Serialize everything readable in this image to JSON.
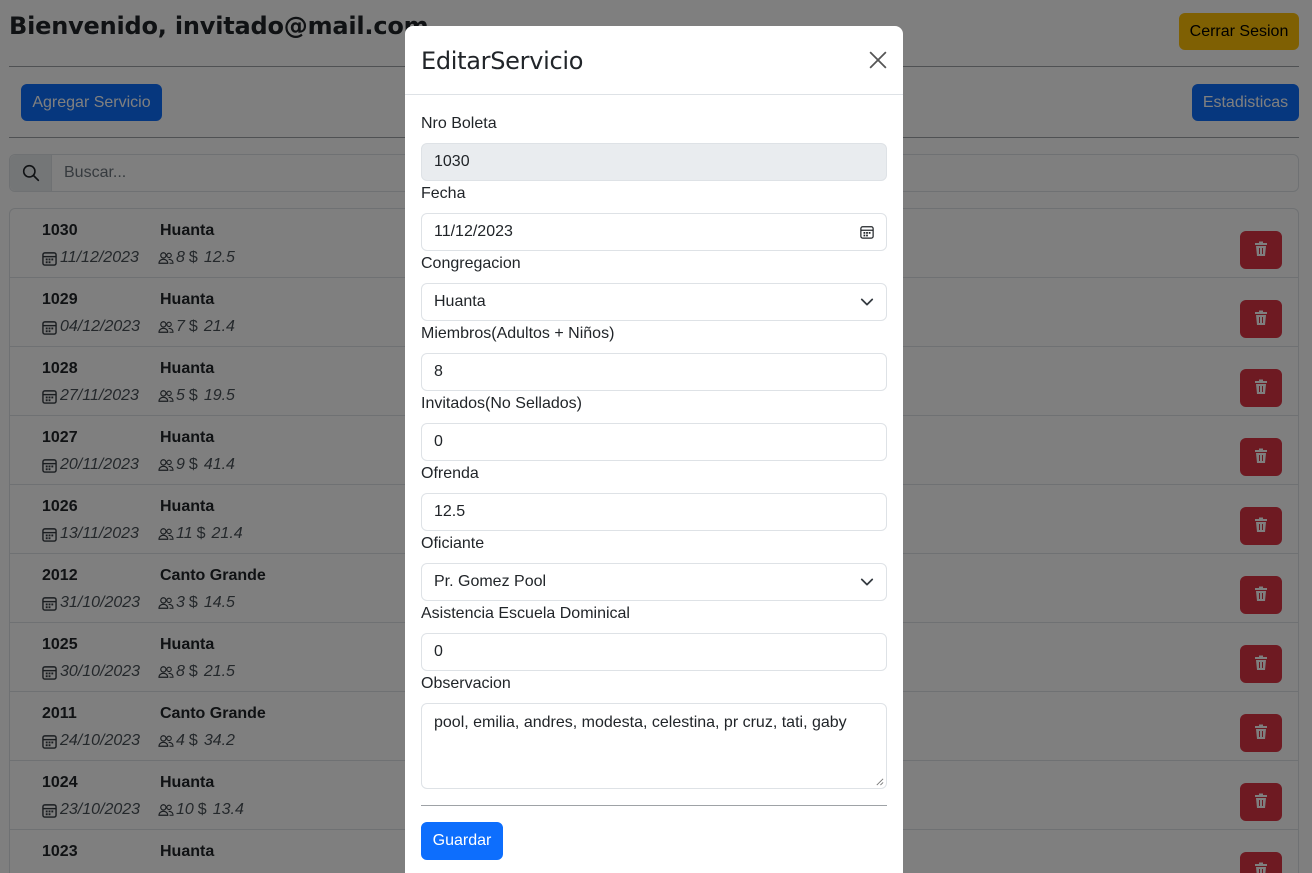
{
  "header": {
    "title": "Bienvenido, invitado@mail.com",
    "logout_label": "Cerrar Sesion"
  },
  "toolbar": {
    "add_label": "Agregar Servicio",
    "stats_label": "Estadisticas"
  },
  "search": {
    "placeholder": "Buscar..."
  },
  "services": [
    {
      "nro": "1030",
      "congregacion": "Huanta",
      "fecha": "11/12/2023",
      "miembros": "8",
      "ofrenda": "12.5"
    },
    {
      "nro": "1029",
      "congregacion": "Huanta",
      "fecha": "04/12/2023",
      "miembros": "7",
      "ofrenda": "21.4"
    },
    {
      "nro": "1028",
      "congregacion": "Huanta",
      "fecha": "27/11/2023",
      "miembros": "5",
      "ofrenda": "19.5"
    },
    {
      "nro": "1027",
      "congregacion": "Huanta",
      "fecha": "20/11/2023",
      "miembros": "9",
      "ofrenda": "41.4"
    },
    {
      "nro": "1026",
      "congregacion": "Huanta",
      "fecha": "13/11/2023",
      "miembros": "11",
      "ofrenda": "21.4"
    },
    {
      "nro": "2012",
      "congregacion": "Canto Grande",
      "fecha": "31/10/2023",
      "miembros": "3",
      "ofrenda": "14.5"
    },
    {
      "nro": "1025",
      "congregacion": "Huanta",
      "fecha": "30/10/2023",
      "miembros": "8",
      "ofrenda": "21.5"
    },
    {
      "nro": "2011",
      "congregacion": "Canto Grande",
      "fecha": "24/10/2023",
      "miembros": "4",
      "ofrenda": "34.2"
    },
    {
      "nro": "1024",
      "congregacion": "Huanta",
      "fecha": "23/10/2023",
      "miembros": "10",
      "ofrenda": "13.4"
    },
    {
      "nro": "1023",
      "congregacion": "Huanta",
      "fecha": "",
      "miembros": "",
      "ofrenda": ""
    }
  ],
  "currency_symbol": "$",
  "modal": {
    "title": "EditarServicio",
    "fields": {
      "nro_boleta": {
        "label": "Nro Boleta",
        "value": "1030"
      },
      "fecha": {
        "label": "Fecha",
        "value": "11/12/2023"
      },
      "congregacion": {
        "label": "Congregacion",
        "value": "Huanta"
      },
      "miembros": {
        "label": "Miembros(Adultos + Niños)",
        "value": "8"
      },
      "invitados": {
        "label": "Invitados(No Sellados)",
        "value": "0"
      },
      "ofrenda": {
        "label": "Ofrenda",
        "value": "12.5"
      },
      "oficiante": {
        "label": "Oficiante",
        "value": "Pr. Gomez Pool"
      },
      "escuela_dominical": {
        "label": "Asistencia Escuela Dominical",
        "value": "0"
      },
      "observacion": {
        "label": "Observacion",
        "value": "pool, emilia, andres, modesta, celestina, pr cruz, tati, gaby"
      }
    },
    "save_label": "Guardar"
  },
  "colors": {
    "primary": "#0d6efd",
    "warning": "#ffc107",
    "danger": "#dc3545",
    "backdrop": "rgba(0,0,0,0.5)"
  }
}
